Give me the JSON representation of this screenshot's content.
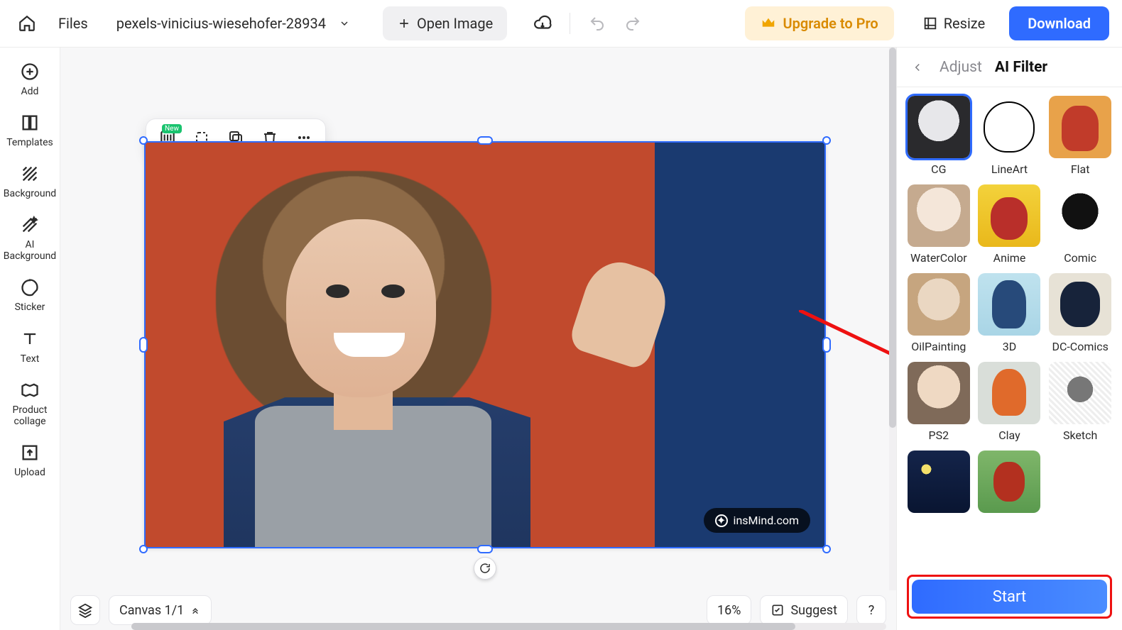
{
  "topbar": {
    "files_label": "Files",
    "filename": "pexels-vinicius-wiesehofer-28934",
    "open_image_label": "Open Image",
    "upgrade_label": "Upgrade to Pro",
    "resize_label": "Resize",
    "download_label": "Download"
  },
  "left_tools": {
    "add": "Add",
    "templates": "Templates",
    "background": "Background",
    "ai_background": "AI Background",
    "sticker": "Sticker",
    "text": "Text",
    "product_collage": "Product collage",
    "upload": "Upload"
  },
  "context_toolbar": {
    "ai_badge": "New"
  },
  "canvas": {
    "watermark": "insMind.com"
  },
  "bottombar": {
    "canvas_label": "Canvas 1/1",
    "zoom_label": "16%",
    "suggest_label": "Suggest",
    "help_label": "?"
  },
  "rightpanel": {
    "tab_adjust": "Adjust",
    "tab_ai_filter": "AI Filter",
    "start_label": "Start",
    "filters": [
      {
        "id": "cg",
        "label": "CG",
        "selected": true
      },
      {
        "id": "lineart",
        "label": "LineArt",
        "selected": false
      },
      {
        "id": "flat",
        "label": "Flat",
        "selected": false
      },
      {
        "id": "watercolor",
        "label": "WaterColor",
        "selected": false
      },
      {
        "id": "anime",
        "label": "Anime",
        "selected": false
      },
      {
        "id": "comic",
        "label": "Comic",
        "selected": false
      },
      {
        "id": "oilpainting",
        "label": "OilPainting",
        "selected": false
      },
      {
        "id": "3d",
        "label": "3D",
        "selected": false
      },
      {
        "id": "dc-comics",
        "label": "DC-Comics",
        "selected": false
      },
      {
        "id": "ps2",
        "label": "PS2",
        "selected": false
      },
      {
        "id": "clay",
        "label": "Clay",
        "selected": false
      },
      {
        "id": "sketch",
        "label": "Sketch",
        "selected": false
      },
      {
        "id": "starry",
        "label": "",
        "selected": false
      },
      {
        "id": "ghibli",
        "label": "",
        "selected": false
      }
    ]
  }
}
